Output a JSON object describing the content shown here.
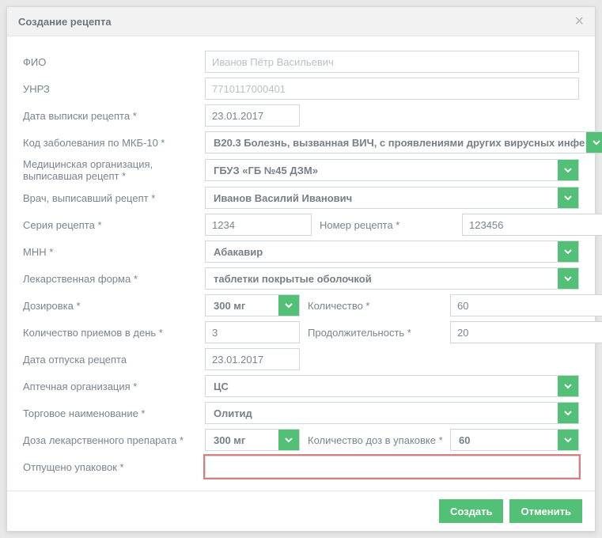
{
  "header": {
    "title": "Создание рецепта"
  },
  "labels": {
    "fio": "ФИО",
    "unrz": "УНРЗ",
    "date_issue": "Дата выписки рецепта  *",
    "mkb": "Код заболевания по МКБ-10  *",
    "org": "Медицинская организация, выписавшая рецепт  *",
    "doctor": "Врач, выписавший рецепт  *",
    "series": "Серия рецепта  *",
    "number": "Номер рецепта  *",
    "mnn": "МНН  *",
    "form": "Лекарственная форма  *",
    "dosage": "Дозировка  *",
    "qty": "Количество  *",
    "per_day": "Количество приемов в день  *",
    "duration": "Продолжительность  *",
    "date_release": "Дата отпуска рецепта",
    "pharmacy": "Аптечная организация  *",
    "trade_name": "Торговое наименование  *",
    "drug_dose": "Доза лекарственного препарата  *",
    "doses_per_pack": "Количество доз в упаковке  *",
    "packs_dispensed": "Отпущено упаковок  *"
  },
  "values": {
    "fio_ph": "Иванов Пётр Васильевич",
    "unrz_ph": "7710117000401",
    "date_issue": "23.01.2017",
    "mkb": "B20.3 Болезнь, вызванная ВИЧ, с проявлениями других вирусных инфе",
    "org": "ГБУЗ «ГБ №45 ДЗМ»",
    "doctor": "Иванов Василий Иванович",
    "series": "1234",
    "number": "123456",
    "mnn": "Абакавир",
    "form": "таблетки покрытые оболочкой",
    "dosage": "300 мг",
    "qty": "60",
    "per_day": "3",
    "duration": "20",
    "date_release": "23.01.2017",
    "pharmacy": "ЦС",
    "trade_name": "Олитид",
    "drug_dose": "300 мг",
    "doses_per_pack": "60",
    "packs_dispensed": ""
  },
  "footer": {
    "create": "Создать",
    "cancel": "Отменить"
  }
}
